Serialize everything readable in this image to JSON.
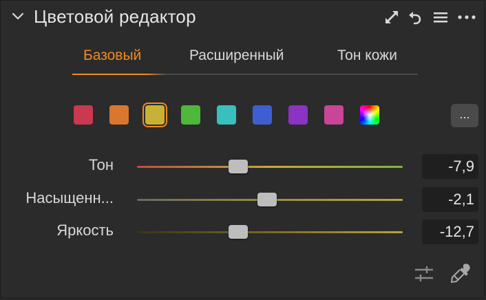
{
  "panel": {
    "title": "Цветовой редактор"
  },
  "header_icons": [
    "expand-icon",
    "reset-icon",
    "menu-icon",
    "more-icon"
  ],
  "tabs": [
    {
      "label": "Базовый",
      "active": true
    },
    {
      "label": "Расширенный",
      "active": false
    },
    {
      "label": "Тон кожи",
      "active": false
    }
  ],
  "swatches": [
    {
      "color": "#c9394f",
      "selected": false
    },
    {
      "color": "#d9772f",
      "selected": false
    },
    {
      "color": "#c9b135",
      "selected": true
    },
    {
      "color": "#4db83a",
      "selected": false
    },
    {
      "color": "#38c0bc",
      "selected": false
    },
    {
      "color": "#3e5fd1",
      "selected": false
    },
    {
      "color": "#8b33c2",
      "selected": false
    },
    {
      "color": "#c84597",
      "selected": false
    },
    {
      "color": "multicolor",
      "selected": false
    }
  ],
  "more_button": {
    "label": "..."
  },
  "sliders": [
    {
      "label": "Тон",
      "value": "-7,9",
      "position": 0.38,
      "colors": [
        "#c04f3c",
        "#c9a93a",
        "#7fb937"
      ]
    },
    {
      "label": "Насыщенн...",
      "value": "-2,1",
      "position": 0.49,
      "colors": [
        "#6a6a60",
        "#9a8f3a",
        "#b9a63a"
      ]
    },
    {
      "label": "Яркость",
      "value": "-12,7",
      "position": 0.38,
      "colors": [
        "#3b3418",
        "#7a6a22",
        "#b9a43a"
      ]
    }
  ],
  "bottom_icons": [
    "adjust-sliders-icon",
    "eyedropper-icon"
  ]
}
